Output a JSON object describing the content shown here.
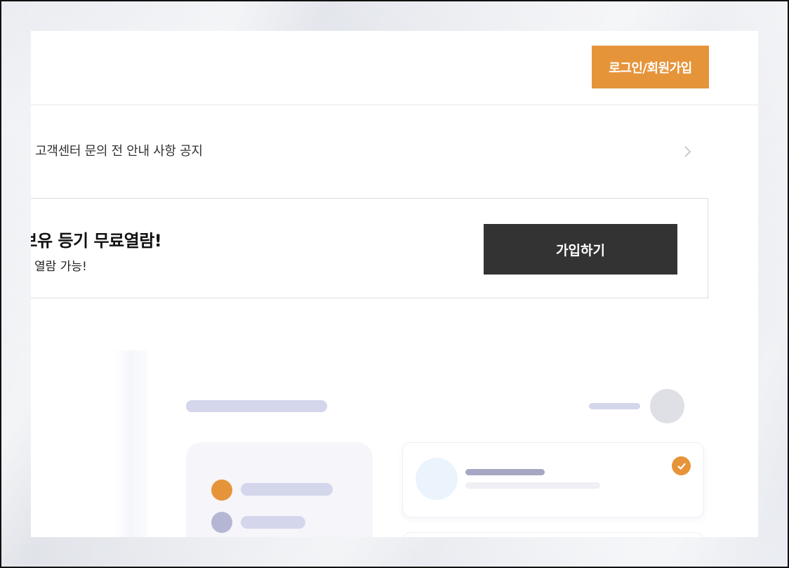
{
  "header": {
    "login_signup_label": "로그인/회원가입"
  },
  "notice": {
    "text": "] 고객센터 문의 전 안내 사항 공지",
    "chevron_icon": "chevron-right-icon"
  },
  "banner": {
    "title": "집 보유 등기 무료열람!",
    "subtitle": "를 열람 가능!",
    "join_label": "가입하기"
  },
  "colors": {
    "accent": "#e6943a",
    "dark_button": "#333333",
    "skeleton": "#d4d6ec"
  },
  "illustration": {
    "check_icon": "check-icon"
  }
}
